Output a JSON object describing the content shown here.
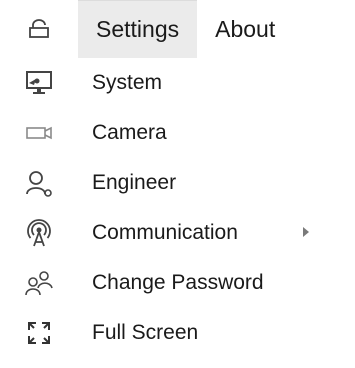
{
  "menubar": {
    "lock_icon": "lock-icon",
    "tabs": [
      {
        "label": "Settings",
        "active": true
      },
      {
        "label": "About",
        "active": false
      }
    ]
  },
  "dropdown": {
    "items": [
      {
        "label": "System",
        "icon": "monitor-tools-icon"
      },
      {
        "label": "Camera",
        "icon": "camera-icon"
      },
      {
        "label": "Engineer",
        "icon": "person-icon"
      },
      {
        "label": "Communication",
        "icon": "antenna-icon",
        "has_submenu": true
      },
      {
        "label": "Change Password",
        "icon": "users-icon"
      },
      {
        "label": "Full Screen",
        "icon": "fullscreen-icon"
      }
    ]
  },
  "colors": {
    "active_tab_bg": "#ebebeb",
    "icon": "#444444"
  }
}
